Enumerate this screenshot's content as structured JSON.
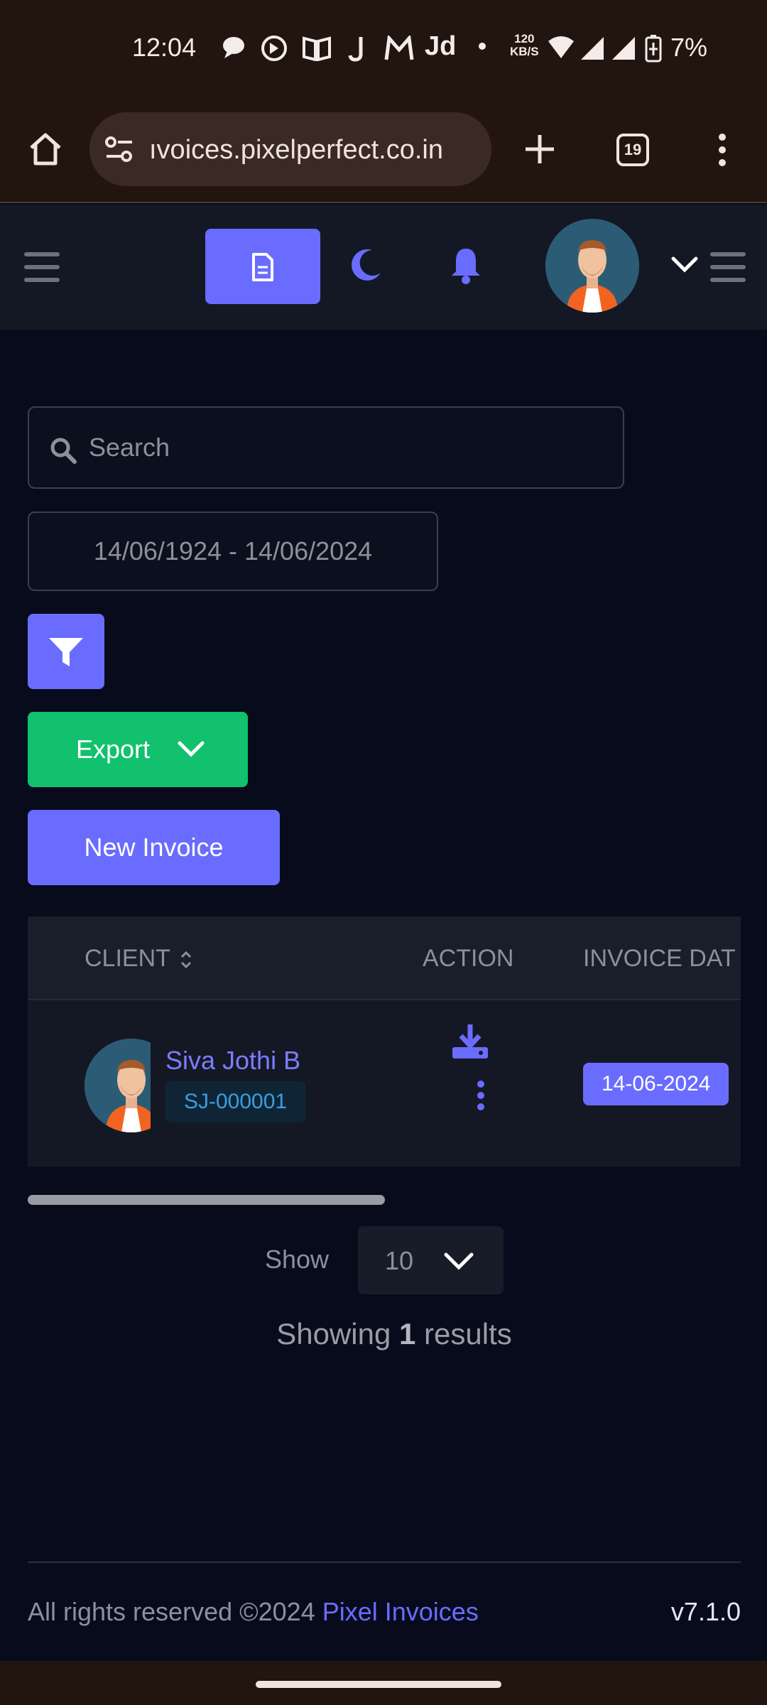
{
  "status_bar": {
    "time": "12:04",
    "notif_icons": [
      "chat-icon",
      "whatsapp-icon",
      "book-icon",
      "j-icon",
      "mm-icon",
      "jd-icon",
      "dot-icon"
    ],
    "notif_text": "J  Jd",
    "speed_value": "120",
    "speed_unit": "KB/S",
    "battery": "7%"
  },
  "browser": {
    "url": "ıvoices.pixelperfect.co.in",
    "tab_count": "19"
  },
  "app_header": {
    "icons": [
      "menu-icon",
      "document-icon",
      "moon-icon",
      "bell-icon",
      "avatar",
      "chevron-down-icon",
      "menu-icon"
    ]
  },
  "filters": {
    "search_placeholder": "Search",
    "date_range": "14/06/1924 - 14/06/2024",
    "export_label": "Export",
    "new_invoice_label": "New Invoice"
  },
  "table": {
    "columns": [
      "CLIENT",
      "ACTION",
      "INVOICE DAT"
    ],
    "rows": [
      {
        "client_name": "Siva Jothi B",
        "client_code": "SJ-000001",
        "invoice_date": "14-06-2024"
      }
    ]
  },
  "pagination": {
    "show_label": "Show",
    "page_size": "10",
    "results_prefix": "Showing",
    "results_count": "1",
    "results_suffix": "results"
  },
  "footer": {
    "copyright": "All rights reserved ©2024",
    "brand": "Pixel Invoices",
    "version": "v7.1.0"
  },
  "colors": {
    "accent": "#6a6cff",
    "export_green": "#11c16d",
    "background": "#080b1c",
    "browser_bar": "#221510"
  }
}
